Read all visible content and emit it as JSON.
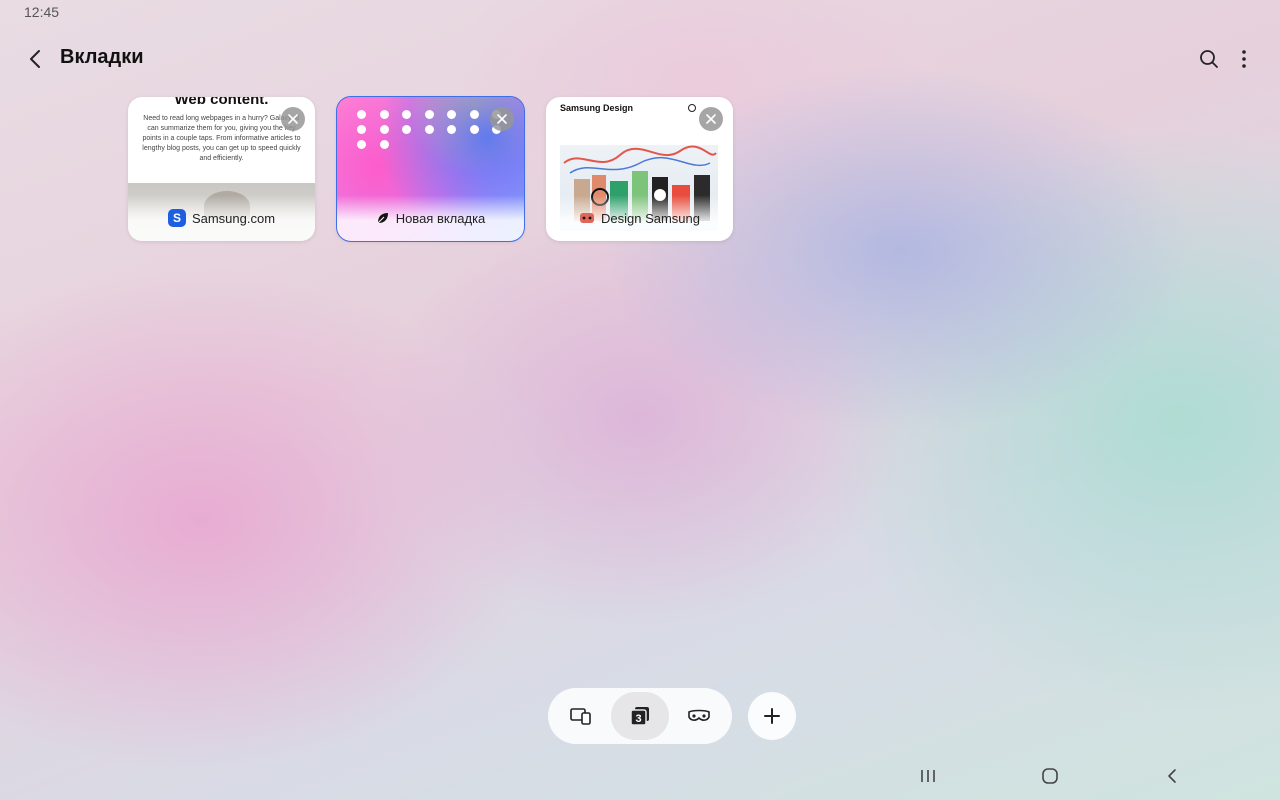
{
  "status": {
    "time": "12:45"
  },
  "header": {
    "title": "Вкладки"
  },
  "tabs": [
    {
      "label": "Samsung.com",
      "icon": "samsung-s-icon",
      "icon_letter": "S",
      "preview_heading": "Web content.",
      "preview_text": "Need to read long webpages in a hurry? Galaxy AI can summarize them for you, giving you the key points in a couple taps. From informative articles to lengthy blog posts, you can get up to speed quickly and efficiently."
    },
    {
      "label": "Новая вкладка",
      "icon": "leaf-icon",
      "active": true
    },
    {
      "label": "Design Samsung",
      "icon": "design-samsung-icon",
      "preview_brand": "Samsung Design"
    }
  ],
  "bottom_bar": {
    "items": [
      {
        "icon": "devices-icon"
      },
      {
        "icon": "tab-count-icon",
        "count": "3",
        "selected": true
      },
      {
        "icon": "secret-mode-icon"
      }
    ],
    "add_icon": "plus-icon"
  },
  "colors": {
    "accent": "#3f6fe6",
    "samsung_blue": "#1d5fe0"
  }
}
